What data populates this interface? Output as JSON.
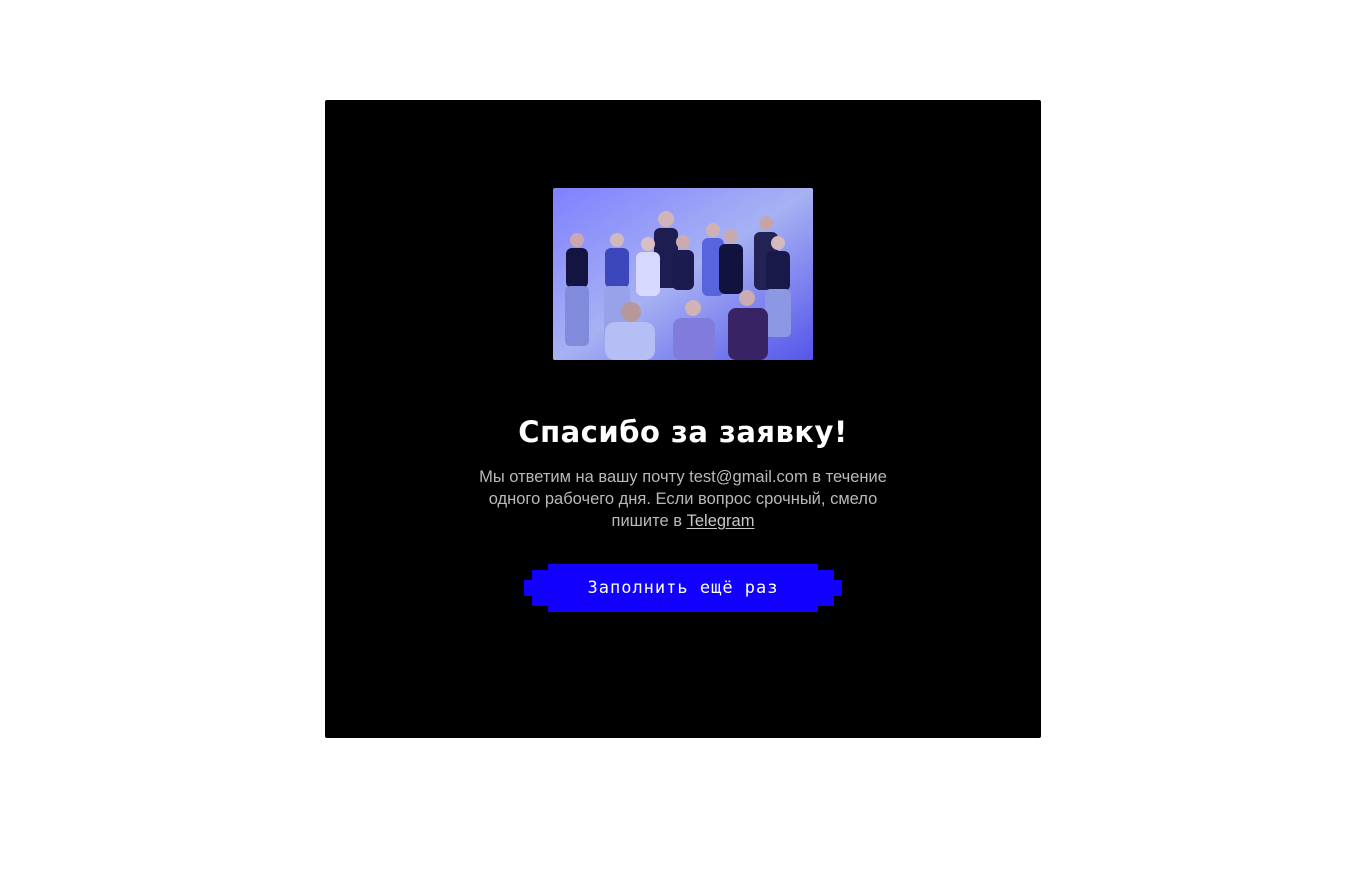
{
  "success": {
    "title": "Спасибо за заявку!",
    "message_before_link": "Мы ответим на вашу почту test@gmail.com в течение одного рабочего дня. Если вопрос срочный, смело пишите в ",
    "telegram_link": "Telegram",
    "retry_button": "Заполнить ещё раз"
  },
  "colors": {
    "modal_background": "#000000",
    "button_accent": "#1200ff",
    "text_primary": "#ffffff",
    "text_secondary": "#b9b9b9"
  },
  "icons": {
    "team_photo": "team-photo"
  }
}
